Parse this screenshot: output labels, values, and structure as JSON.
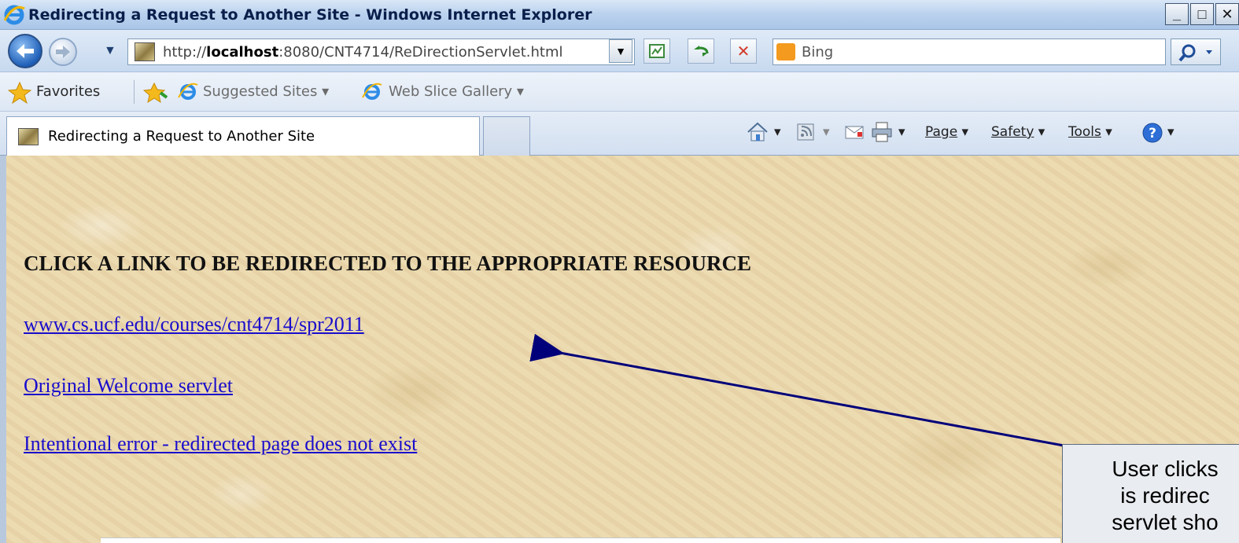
{
  "window": {
    "title": "Redirecting a Request to Another Site - Windows Internet Explorer",
    "min_glyph": "_",
    "max_glyph": "□",
    "close_glyph": "✕"
  },
  "nav": {
    "address": "http://localhost:8080/CNT4714/ReDirectionServlet.html",
    "address_prefix": "http://",
    "address_host": "localhost",
    "address_rest": ":8080/CNT4714/ReDirectionServlet.html",
    "search_value": "Bing"
  },
  "favorites": {
    "label": "Favorites",
    "items": [
      "Suggested Sites ▾",
      "Web Slice Gallery ▾"
    ]
  },
  "tab": {
    "label": "Redirecting a Request to Another Site"
  },
  "command_bar": {
    "page": "Page",
    "safety": "Safety",
    "tools": "Tools"
  },
  "page": {
    "heading": "CLICK A LINK TO BE REDIRECTED TO THE APPROPRIATE RESOURCE",
    "links": [
      "www.cs.ucf.edu/courses/cnt4714/spr2011",
      "Original Welcome servlet",
      "Intentional error - redirected page does not exist"
    ],
    "background_color": "#ead8ae",
    "link_color": "#1a0dcc"
  },
  "annotation": {
    "lines": [
      "User clicks",
      "is redirec",
      "servlet sho"
    ]
  }
}
